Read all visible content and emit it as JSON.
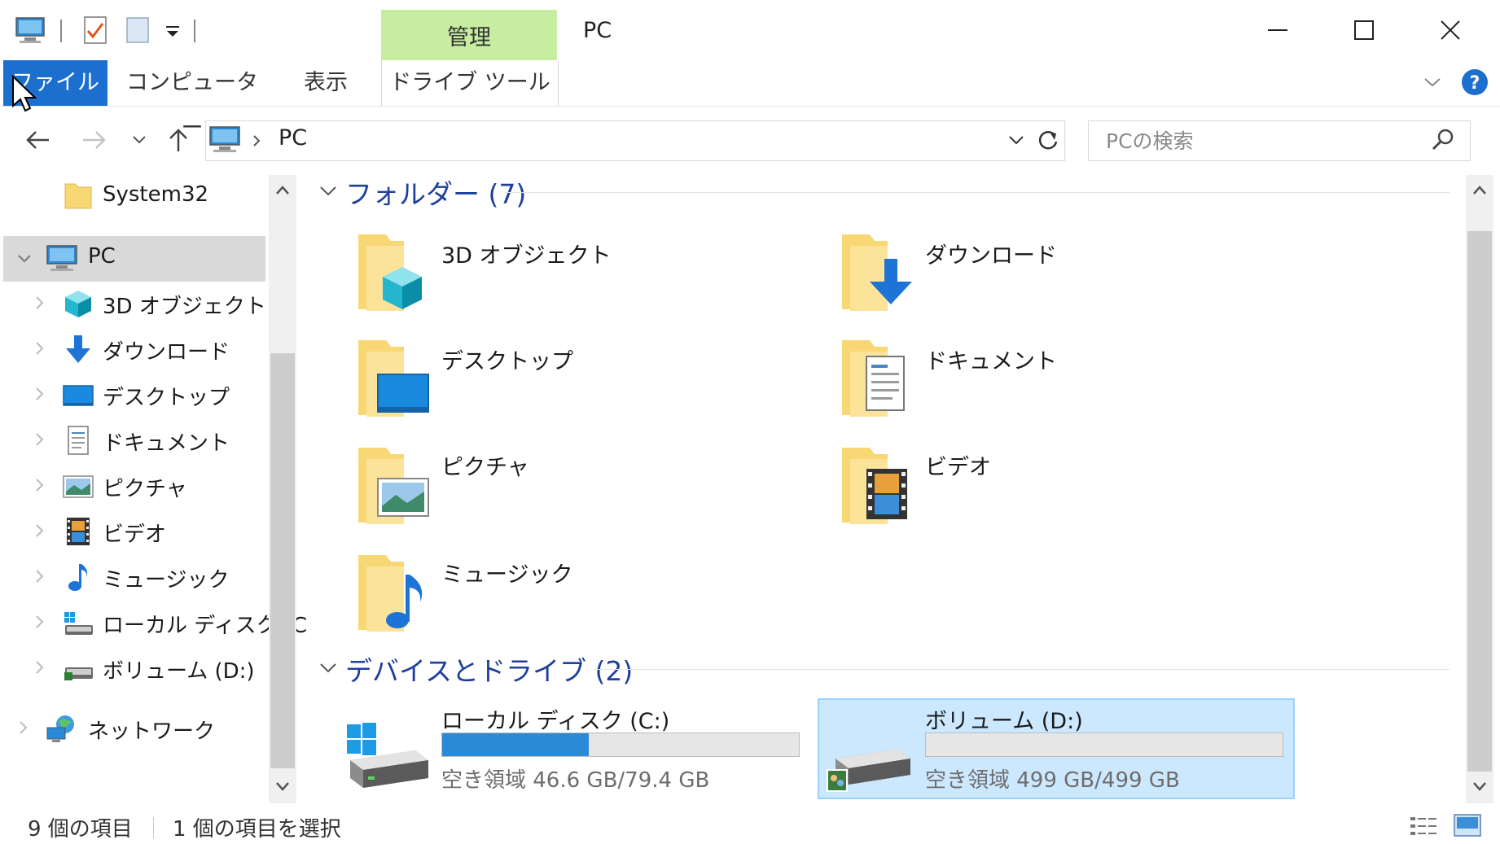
{
  "window": {
    "title": "PC",
    "context_tab": "管理"
  },
  "ribbon": {
    "tabs": [
      {
        "label": "ファイル",
        "active": true
      },
      {
        "label": "コンピューター"
      },
      {
        "label": "表示"
      },
      {
        "label": "ドライブ ツール"
      }
    ]
  },
  "address": {
    "path": "PC"
  },
  "search": {
    "placeholder": "PCの検索"
  },
  "nav": {
    "items": [
      {
        "label": "System32",
        "icon": "folder-icon"
      },
      {
        "label": "PC",
        "icon": "computer-icon",
        "selected": true
      },
      {
        "label": "3D オブジェクト",
        "icon": "3d-objects-icon"
      },
      {
        "label": "ダウンロード",
        "icon": "download-icon"
      },
      {
        "label": "デスクトップ",
        "icon": "desktop-icon"
      },
      {
        "label": "ドキュメント",
        "icon": "document-icon"
      },
      {
        "label": "ピクチャ",
        "icon": "pictures-icon"
      },
      {
        "label": "ビデオ",
        "icon": "video-icon"
      },
      {
        "label": "ミュージック",
        "icon": "music-icon"
      },
      {
        "label": "ローカル ディスク (C",
        "icon": "local-disk-icon"
      },
      {
        "label": "ボリューム (D:)",
        "icon": "volume-icon"
      },
      {
        "label": "ネットワーク",
        "icon": "network-icon"
      }
    ]
  },
  "folders": {
    "header": "フォルダー (7)",
    "items": [
      {
        "label": "3D オブジェクト",
        "icon": "3d-objects-folder-icon"
      },
      {
        "label": "ダウンロード",
        "icon": "downloads-folder-icon"
      },
      {
        "label": "デスクトップ",
        "icon": "desktop-folder-icon"
      },
      {
        "label": "ドキュメント",
        "icon": "documents-folder-icon"
      },
      {
        "label": "ピクチャ",
        "icon": "pictures-folder-icon"
      },
      {
        "label": "ビデオ",
        "icon": "videos-folder-icon"
      },
      {
        "label": "ミュージック",
        "icon": "music-folder-icon"
      }
    ]
  },
  "drives": {
    "header": "デバイスとドライブ (2)",
    "items": [
      {
        "label": "ローカル ディスク (C:)",
        "free": "空き領域 46.6 GB/79.4 GB",
        "used_fraction": 0.41,
        "icon": "windows-drive-icon"
      },
      {
        "label": "ボリューム (D:)",
        "free": "空き領域 499 GB/499 GB",
        "used_fraction": 0.0,
        "selected": true,
        "icon": "network-drive-icon"
      }
    ]
  },
  "status": {
    "count": "9 個の項目",
    "selection": "1 個の項目を選択"
  },
  "colors": {
    "accent": "#1c6fcf",
    "context_tab": "#c6eda0",
    "section_header": "#1e3f9b",
    "selection": "#cce8ff"
  }
}
